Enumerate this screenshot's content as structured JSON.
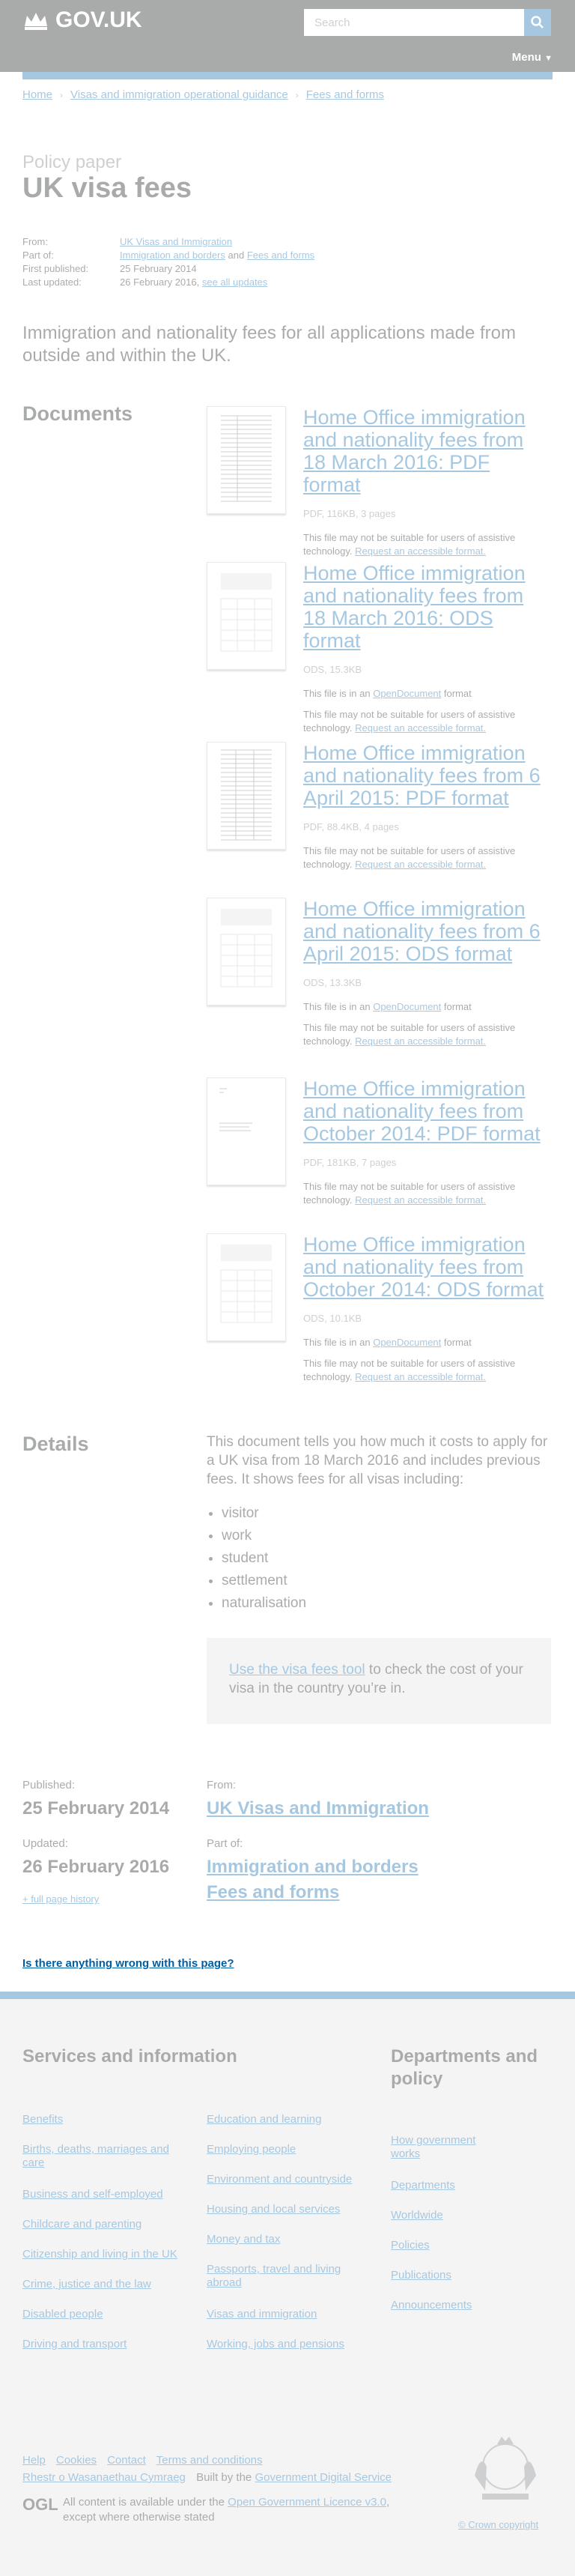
{
  "header": {
    "logo_text": "GOV.UK",
    "search_placeholder": "Search",
    "menu_label": "Menu"
  },
  "breadcrumbs": [
    "Home",
    "Visas and immigration operational guidance",
    "Fees and forms"
  ],
  "doc_type": "Policy paper",
  "title": "UK visa fees",
  "metadata": {
    "from_label": "From:",
    "from_value": "UK Visas and Immigration",
    "partof_label": "Part of:",
    "partof_1": "Immigration and borders",
    "partof_and": "and",
    "partof_2": "Fees and forms",
    "published_label": "First published:",
    "published_value": "25 February 2014",
    "updated_label": "Last updated:",
    "updated_value": "26 February 2016,",
    "see_updates": "see all updates"
  },
  "lead": "Immigration and nationality fees for all applications made from outside and within the UK.",
  "documents_heading": "Documents",
  "attachments": [
    {
      "title": "Home Office immigration and nationality fees from 18 March 2016: PDF format",
      "meta": "PDF, 116KB, 3 pages",
      "opendoc_prefix": "",
      "opendoc_link": "",
      "opendoc_suffix": "",
      "note": "This file may not be suitable for users of assistive technology.",
      "request": "Request an accessible format."
    },
    {
      "title": "Home Office immigration and nationality fees from 18 March 2016: ODS format",
      "meta": "ODS, 15.3KB",
      "opendoc_prefix": "This file is in an",
      "opendoc_link": "OpenDocument",
      "opendoc_suffix": "format",
      "note": "This file may not be suitable for users of assistive technology.",
      "request": "Request an accessible format."
    },
    {
      "title": "Home Office immigration and nationality fees from 6 April 2015: PDF format",
      "meta": "PDF, 88.4KB, 4 pages",
      "opendoc_prefix": "",
      "opendoc_link": "",
      "opendoc_suffix": "",
      "note": "This file may not be suitable for users of assistive technology.",
      "request": "Request an accessible format."
    },
    {
      "title": "Home Office immigration and nationality fees from 6 April 2015: ODS format",
      "meta": "ODS, 13.3KB",
      "opendoc_prefix": "This file is in an",
      "opendoc_link": "OpenDocument",
      "opendoc_suffix": "format",
      "note": "This file may not be suitable for users of assistive technology.",
      "request": "Request an accessible format."
    },
    {
      "title": "Home Office immigration and nationality fees from October 2014: PDF format",
      "meta": "PDF, 181KB, 7 pages",
      "opendoc_prefix": "",
      "opendoc_link": "",
      "opendoc_suffix": "",
      "note": "This file may not be suitable for users of assistive technology.",
      "request": "Request an accessible format."
    },
    {
      "title": "Home Office immigration and nationality fees from October 2014: ODS format",
      "meta": "ODS, 10.1KB",
      "opendoc_prefix": "This file is in an",
      "opendoc_link": "OpenDocument",
      "opendoc_suffix": "format",
      "note": "This file may not be suitable for users of assistive technology.",
      "request": "Request an accessible format."
    }
  ],
  "details": {
    "heading": "Details",
    "body": "This document tells you how much it costs to apply for a UK visa from 18 March 2016 and includes previous fees. It shows fees for all visas including:",
    "list": [
      "visitor",
      "work",
      "student",
      "settlement",
      "naturalisation"
    ],
    "inset_link": "Use the visa fees tool",
    "inset_text": " to check the cost of your visa in the country you’re in."
  },
  "published_block": {
    "published_label": "Published:",
    "published_value": "25 February 2014",
    "updated_label": "Updated:",
    "updated_value": "26 February 2016",
    "history_link": "+ full page history",
    "from_label": "From:",
    "from_value": "UK Visas and Immigration",
    "partof_label": "Part of:",
    "partof_1": "Immigration and borders",
    "partof_2": "Fees and forms"
  },
  "report_link": "Is there anything wrong with this page?",
  "footer": {
    "services_heading": "Services and information",
    "col1": [
      "Benefits",
      "Births, deaths, marriages and care",
      "Business and self-employed",
      "Childcare and parenting",
      "Citizenship and living in the UK",
      "Crime, justice and the law",
      "Disabled people",
      "Driving and transport"
    ],
    "col2": [
      "Education and learning",
      "Employing people",
      "Environment and countryside",
      "Housing and local services",
      "Money and tax",
      "Passports, travel and living abroad",
      "Visas and immigration",
      "Working, jobs and pensions"
    ],
    "departments_heading": "Departments and policy",
    "col3": [
      "How government works",
      "Departments",
      "Worldwide",
      "Policies",
      "Publications",
      "Announcements"
    ],
    "bottom_links": [
      "Help",
      "Cookies",
      "Contact",
      "Terms and conditions"
    ],
    "welsh": "Rhestr o Wasanaethau Cymraeg",
    "built_by_prefix": "Built by the",
    "built_by_link": "Government Digital Service",
    "ogl": "OGL",
    "licence_prefix": "All content is available under the",
    "licence_link": "Open Government Licence v3.0",
    "licence_suffix": ", except where otherwise stated",
    "copyright": "© Crown copyright"
  }
}
